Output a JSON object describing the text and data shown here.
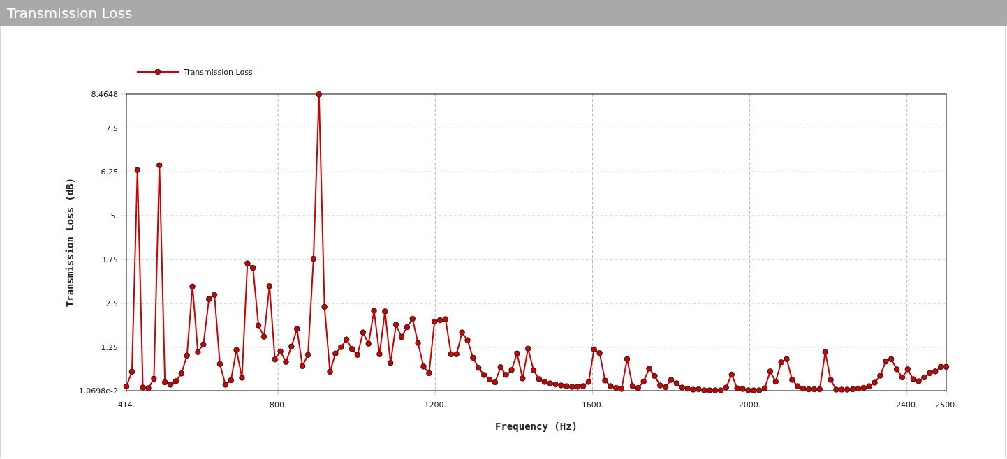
{
  "panel": {
    "title": "Transmission Loss",
    "chart_data": {
      "type": "line",
      "grid": true,
      "xlabel": "Frequency (Hz)",
      "ylabel": "Transmission Loss (dB)",
      "xlim": [
        414,
        2500
      ],
      "ylim": [
        0.010698,
        8.4648
      ],
      "xticks": [
        {
          "value": 414,
          "label": "414."
        },
        {
          "value": 800,
          "label": "800."
        },
        {
          "value": 1200,
          "label": "1200."
        },
        {
          "value": 1600,
          "label": "1600."
        },
        {
          "value": 2000,
          "label": "2000."
        },
        {
          "value": 2400,
          "label": "2400."
        },
        {
          "value": 2500,
          "label": "2500."
        }
      ],
      "yticks": [
        {
          "value": 0.010698,
          "label": "1.0698e-2"
        },
        {
          "value": 1.25,
          "label": "1.25"
        },
        {
          "value": 2.5,
          "label": "2.5"
        },
        {
          "value": 3.75,
          "label": "3.75"
        },
        {
          "value": 5,
          "label": "5."
        },
        {
          "value": 6.25,
          "label": "6.25"
        },
        {
          "value": 7.5,
          "label": "7.5"
        },
        {
          "value": 8.4648,
          "label": "8.4648"
        }
      ],
      "x": [
        414,
        428,
        442,
        456,
        470,
        484,
        498,
        512,
        526,
        540,
        554,
        568,
        582,
        596,
        610,
        624,
        638,
        652,
        666,
        680,
        694,
        708,
        722,
        736,
        750,
        764,
        778,
        792,
        806,
        820,
        834,
        848,
        862,
        876,
        890,
        904,
        918,
        932,
        946,
        960,
        974,
        988,
        1002,
        1016,
        1030,
        1044,
        1058,
        1072,
        1086,
        1100,
        1114,
        1128,
        1142,
        1156,
        1170,
        1184,
        1198,
        1212,
        1226,
        1240,
        1254,
        1268,
        1282,
        1296,
        1310,
        1324,
        1338,
        1352,
        1366,
        1380,
        1394,
        1408,
        1422,
        1436,
        1450,
        1464,
        1478,
        1492,
        1506,
        1520,
        1534,
        1548,
        1562,
        1576,
        1590,
        1604,
        1618,
        1632,
        1646,
        1660,
        1674,
        1688,
        1702,
        1716,
        1730,
        1744,
        1758,
        1772,
        1786,
        1800,
        1814,
        1828,
        1842,
        1856,
        1870,
        1884,
        1898,
        1912,
        1926,
        1940,
        1954,
        1968,
        1982,
        1996,
        2010,
        2024,
        2038,
        2052,
        2066,
        2080,
        2094,
        2108,
        2122,
        2136,
        2150,
        2164,
        2178,
        2192,
        2206,
        2220,
        2234,
        2248,
        2262,
        2276,
        2290,
        2304,
        2318,
        2332,
        2346,
        2360,
        2374,
        2388,
        2402,
        2416,
        2430,
        2444,
        2458,
        2472,
        2486,
        2500
      ],
      "series": [
        {
          "name": "Transmission Loss",
          "color": "#cc0000",
          "marker": true,
          "values": [
            0.13,
            0.55,
            6.3,
            0.1,
            0.08,
            0.35,
            6.44,
            0.25,
            0.18,
            0.28,
            0.5,
            1.01,
            2.98,
            1.11,
            1.33,
            2.62,
            2.74,
            0.77,
            0.18,
            0.31,
            1.17,
            0.38,
            3.64,
            3.51,
            1.87,
            1.55,
            2.99,
            0.9,
            1.13,
            0.83,
            1.27,
            1.77,
            0.71,
            1.03,
            3.77,
            8.46,
            2.4,
            0.55,
            1.07,
            1.25,
            1.47,
            1.2,
            1.03,
            1.67,
            1.35,
            2.29,
            1.05,
            2.27,
            0.8,
            1.89,
            1.54,
            1.82,
            2.06,
            1.37,
            0.7,
            0.51,
            1.98,
            2.02,
            2.05,
            1.05,
            1.05,
            1.67,
            1.45,
            0.95,
            0.66,
            0.46,
            0.33,
            0.25,
            0.68,
            0.46,
            0.6,
            1.07,
            0.36,
            1.21,
            0.59,
            0.34,
            0.26,
            0.22,
            0.19,
            0.16,
            0.14,
            0.12,
            0.12,
            0.14,
            0.26,
            1.19,
            1.08,
            0.3,
            0.14,
            0.09,
            0.06,
            0.91,
            0.14,
            0.09,
            0.27,
            0.64,
            0.43,
            0.16,
            0.11,
            0.32,
            0.22,
            0.1,
            0.07,
            0.04,
            0.05,
            0.02,
            0.02,
            0.02,
            0.02,
            0.1,
            0.47,
            0.08,
            0.06,
            0.02,
            0.02,
            0.02,
            0.08,
            0.56,
            0.27,
            0.82,
            0.91,
            0.32,
            0.14,
            0.07,
            0.05,
            0.05,
            0.05,
            1.11,
            0.32,
            0.04,
            0.04,
            0.04,
            0.05,
            0.07,
            0.09,
            0.14,
            0.24,
            0.44,
            0.84,
            0.91,
            0.62,
            0.39,
            0.62,
            0.34,
            0.28,
            0.39,
            0.51,
            0.56,
            0.69,
            0.69
          ]
        }
      ]
    }
  }
}
